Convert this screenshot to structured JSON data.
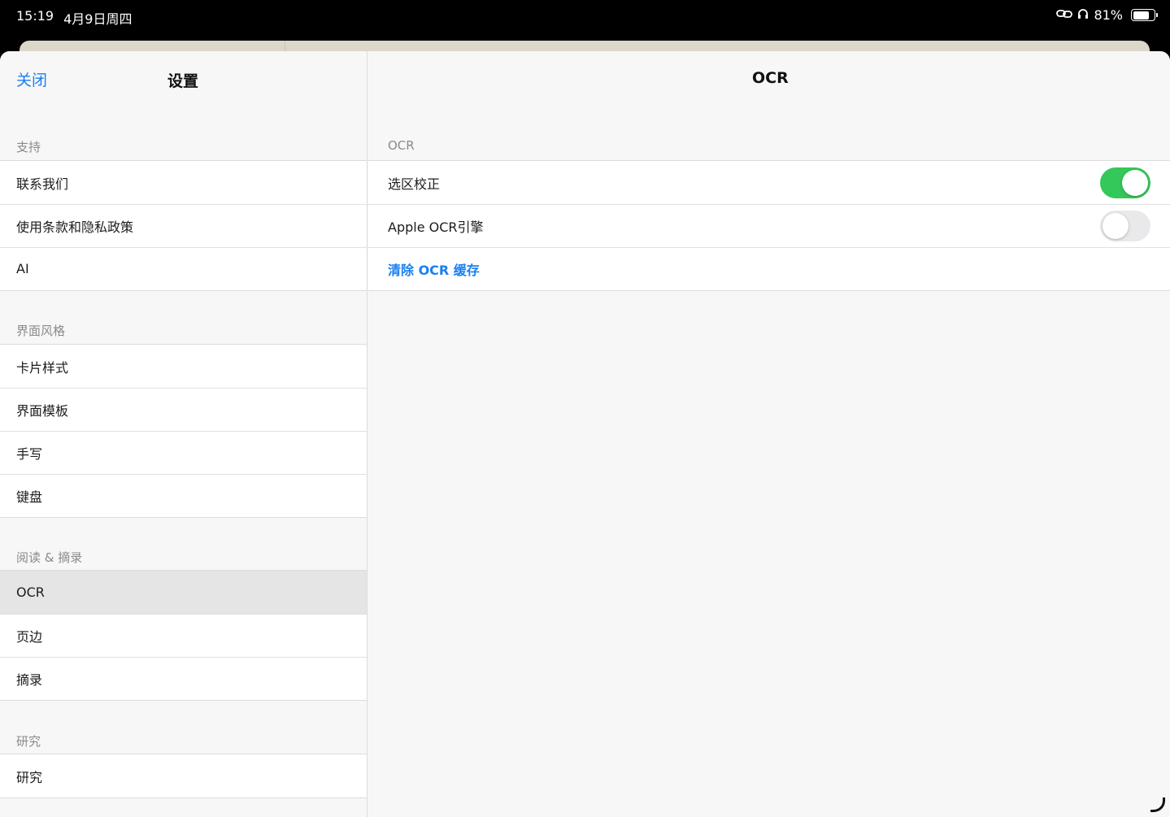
{
  "status_bar": {
    "time": "15:19",
    "date": "4月9日周四",
    "battery_text": "81%",
    "battery_level": 0.81
  },
  "sidebar": {
    "close_label": "关闭",
    "title": "设置",
    "sections": [
      {
        "header": "支持",
        "items": [
          "联系我们",
          "使用条款和隐私政策",
          "AI"
        ]
      },
      {
        "header": "界面风格",
        "items": [
          "卡片样式",
          "界面模板",
          "手写",
          "键盘"
        ]
      },
      {
        "header": "阅读 & 摘录",
        "items": [
          "OCR",
          "页边",
          "摘录"
        ]
      },
      {
        "header": "研究",
        "items": [
          "研究"
        ]
      }
    ],
    "selected_item": "OCR"
  },
  "detail": {
    "title": "OCR",
    "section_header": "OCR",
    "rows": [
      {
        "label": "选区校正",
        "toggle_on": true
      },
      {
        "label": "Apple OCR引擎",
        "toggle_on": false
      }
    ],
    "clear_cache_label": "清除 OCR 缓存"
  },
  "colors": {
    "accent": "#1a7ff0",
    "toggle_on": "#34c759",
    "toggle_off": "#e9e9eb"
  }
}
